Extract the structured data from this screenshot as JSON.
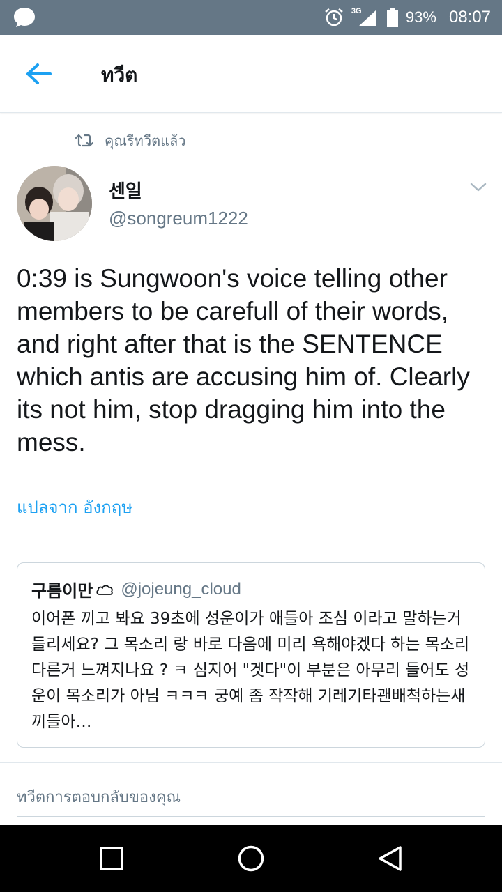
{
  "status_bar": {
    "app_icon": "chat-bubble-icon",
    "alarm_icon": "alarm-icon",
    "network_type": "3G",
    "signal_icon": "signal-icon",
    "battery_icon": "battery-icon",
    "battery_percent": "93%",
    "time": "08:07"
  },
  "header": {
    "back_icon": "arrow-left-icon",
    "title": "ทวีต"
  },
  "retweet_context": {
    "icon": "retweet-icon",
    "label": "คุณรีทวีตแล้ว"
  },
  "tweet": {
    "author_name": "센일",
    "author_handle": "@songreum1222",
    "text": "0:39 is Sungwoon's voice telling other members to be carefull of their words, and right after that is the SENTENCE which antis are accusing him of. Clearly its not him, stop dragging him into the mess.",
    "translate_label": "แปลจาก อังกฤษ"
  },
  "quote": {
    "name": "구름이만",
    "name_icon": "cloud-icon",
    "handle": "@jojeung_cloud",
    "text": "이어폰 끼고 봐요 39초에 성운이가 애들아 조심 이라고 말하는거 들리세요? 그 목소리 랑 바로 다음에 미리 욕해야겠다 하는 목소리 다른거 느껴지나요 ? ㅋ 심지어 \"겟다\"이 부분은 아무리 들어도 성운이 목소리가 아님 ㅋㅋㅋ 궁예 좀 작작해 기레기타괜배척하는새끼들아…"
  },
  "reply": {
    "placeholder": "ทวีตการตอบกลับของคุณ"
  },
  "colors": {
    "status_bar": "#657786",
    "accent": "#1da1f2",
    "secondary_text": "#657786",
    "primary_text": "#14171a"
  }
}
